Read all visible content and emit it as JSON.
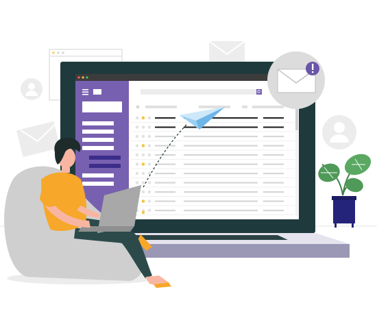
{
  "illustration": {
    "subject": "",
    "colors": {
      "laptop_frame": "#1f3a3d",
      "laptop_base": "#e4e3ee",
      "laptop_base_shadow": "#9a98b5",
      "sidebar_purple": "#7860b0",
      "sidebar_accent": "#3b2d8a",
      "screen_header": "#3c3c3c",
      "paper_plane": "#9ad0f2",
      "alert_badge": "#6a55a8",
      "person_shirt": "#f7a72a",
      "person_pants": "#2c4a4a",
      "person_hair": "#1d2b2b",
      "person_skin": "#f8b6a2",
      "beanbag": "#cfcfcf",
      "plant_leaf": "#4f9a58",
      "plant_pot": "#24247a",
      "avatar_circle": "#ececec",
      "envelope": "#ededed",
      "star_yellow": "#f7c23c"
    },
    "icons": [
      "menu-icon",
      "search-icon",
      "envelope-icon",
      "alert-icon",
      "paper-plane-icon",
      "user-avatar-icon",
      "laptop-icon",
      "plant-icon"
    ]
  },
  "inbox_rows": 11
}
